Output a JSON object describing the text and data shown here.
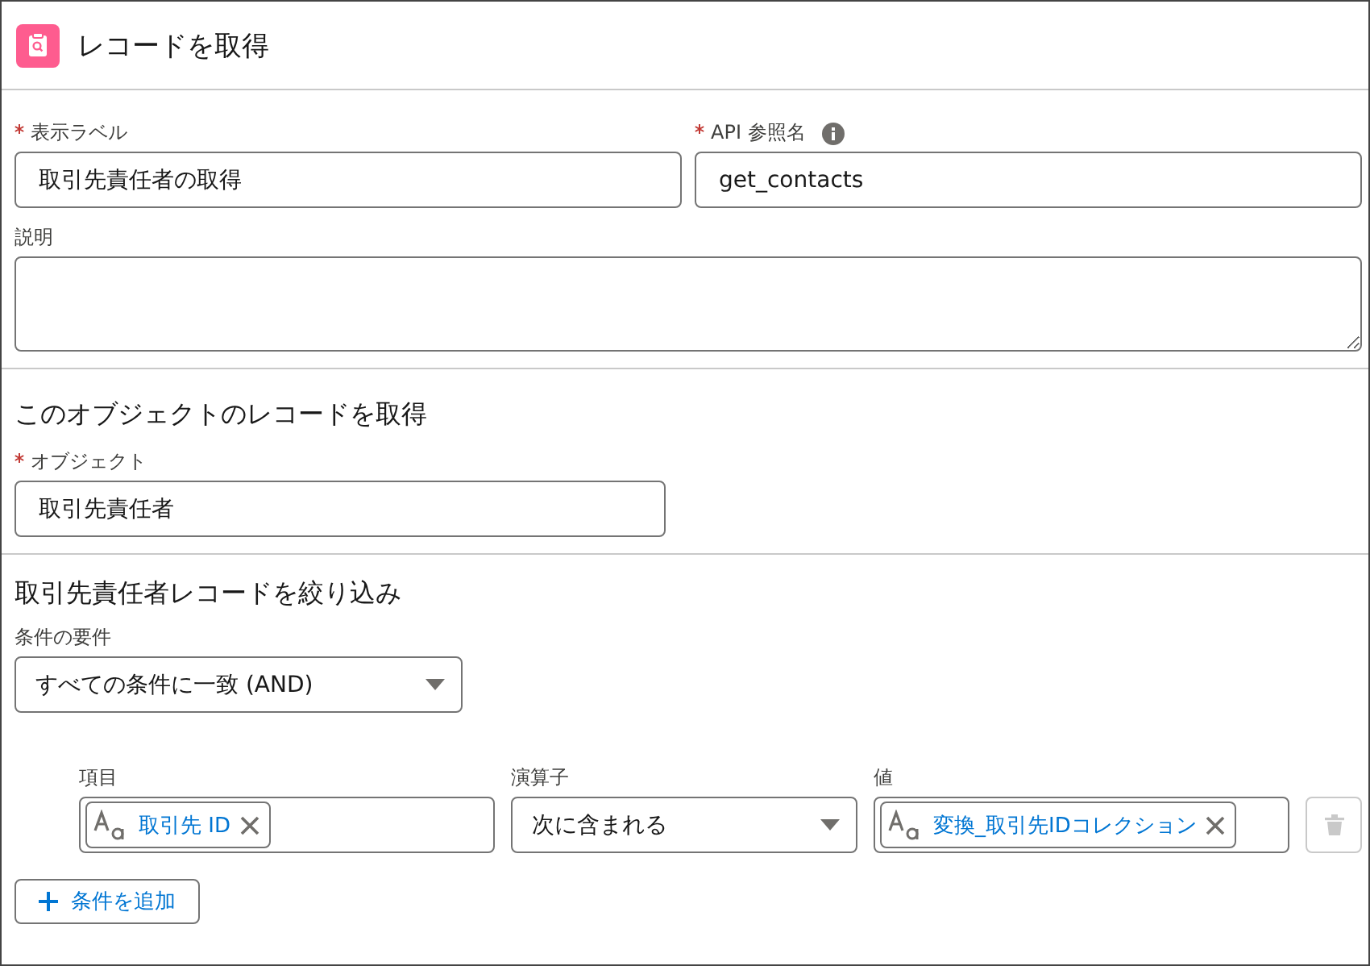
{
  "header": {
    "title": "レコードを取得"
  },
  "fields": [
    {
      "label": "表示ラベル",
      "required": true,
      "info": false,
      "value": "取引先責任者の取得"
    },
    {
      "label": "API 参照名",
      "required": true,
      "info": true,
      "value": "get_contacts"
    }
  ],
  "description": {
    "label": "説明"
  },
  "object_section": {
    "heading": "このオブジェクトのレコードを取得",
    "field": {
      "label": "オブジェクト",
      "required": true,
      "value": "取引先責任者"
    }
  },
  "filter_section": {
    "heading": "取引先責任者レコードを絞り込み",
    "requirement": {
      "label": "条件の要件",
      "value": "すべての条件に一致 (AND)"
    },
    "conditions": [
      {
        "field_label": "項目",
        "field": "取引先 ID",
        "operator_label": "演算子",
        "operator": "次に含まれる",
        "value_label": "値",
        "value": "変換_取引先IDコレクション",
        "delete_disabled": true
      }
    ],
    "add_button": "条件を追加"
  }
}
